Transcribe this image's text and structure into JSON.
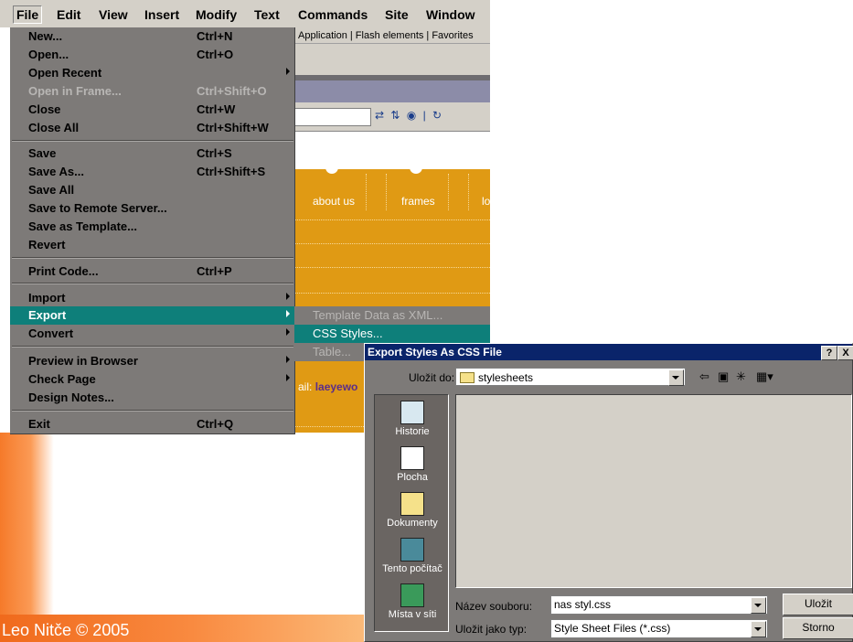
{
  "menubar": {
    "items": [
      "File",
      "Edit",
      "View",
      "Insert",
      "Modify",
      "Text",
      "Commands",
      "Site",
      "Window"
    ]
  },
  "app": {
    "insert_tabs": "Application  |  Flash elements  |  Favorites",
    "nav_links": [
      "about us",
      "frames",
      "lo"
    ],
    "email_label": "ail:",
    "email_value": "laeyewo",
    "footer": "Leo Nitče © 2005"
  },
  "file_menu": {
    "items": [
      {
        "label": "New...",
        "shortcut": "Ctrl+N"
      },
      {
        "label": "Open...",
        "shortcut": "Ctrl+O"
      },
      {
        "label": "Open Recent",
        "shortcut": ""
      },
      {
        "label": "Open in Frame...",
        "shortcut": "Ctrl+Shift+O"
      },
      {
        "label": "Close",
        "shortcut": "Ctrl+W"
      },
      {
        "label": "Close All",
        "shortcut": "Ctrl+Shift+W"
      },
      {
        "label": "Save",
        "shortcut": "Ctrl+S"
      },
      {
        "label": "Save As...",
        "shortcut": "Ctrl+Shift+S"
      },
      {
        "label": "Save All",
        "shortcut": ""
      },
      {
        "label": "Save to Remote Server...",
        "shortcut": ""
      },
      {
        "label": "Save as Template...",
        "shortcut": ""
      },
      {
        "label": "Revert",
        "shortcut": ""
      },
      {
        "label": "Print Code...",
        "shortcut": "Ctrl+P"
      },
      {
        "label": "Import",
        "shortcut": ""
      },
      {
        "label": "Export",
        "shortcut": ""
      },
      {
        "label": "Convert",
        "shortcut": ""
      },
      {
        "label": "Preview in Browser",
        "shortcut": ""
      },
      {
        "label": "Check Page",
        "shortcut": ""
      },
      {
        "label": "Design Notes...",
        "shortcut": ""
      },
      {
        "label": "Exit",
        "shortcut": "Ctrl+Q"
      }
    ]
  },
  "export_submenu": {
    "items": [
      "Template Data as XML...",
      "CSS Styles...",
      "Table..."
    ]
  },
  "dialog": {
    "title": "Export Styles As CSS File",
    "help_btn": "?",
    "close_btn": "X",
    "lookin_label": "Uložit do:",
    "lookin_value": "stylesheets",
    "places": [
      "Historie",
      "Plocha",
      "Dokumenty",
      "Tento počítač",
      "Místa v síti"
    ],
    "filename_label": "Název souboru:",
    "filename_value": "nas styl.css",
    "filetype_label": "Uložit jako typ:",
    "filetype_value": "Style Sheet Files (*.css)",
    "save_btn": "Uložit",
    "cancel_btn": "Storno"
  }
}
